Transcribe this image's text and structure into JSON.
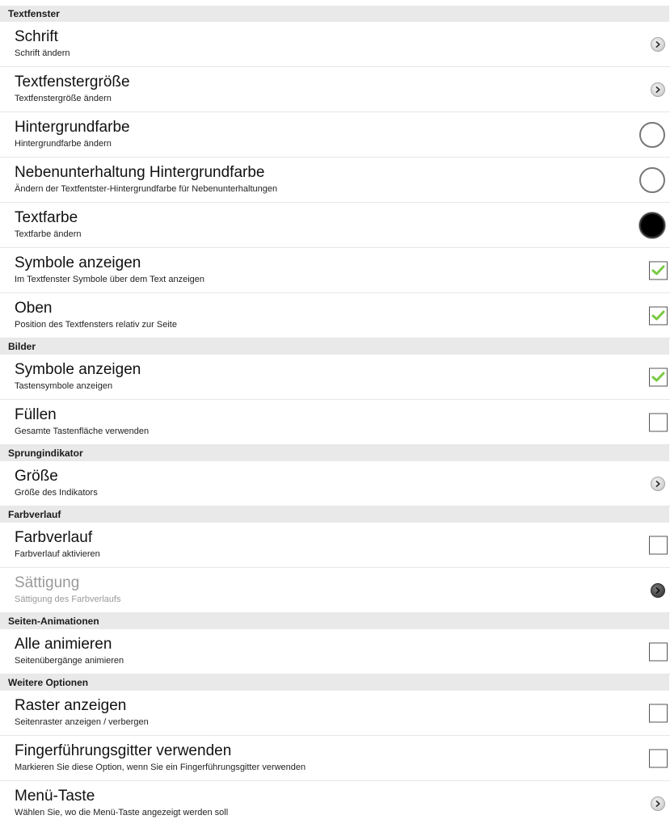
{
  "sections": [
    {
      "header": "Textfenster",
      "rows": [
        {
          "title": "Schrift",
          "subtitle": "Schrift ändern",
          "control": "arrow"
        },
        {
          "title": "Textfenstergröße",
          "subtitle": "Textfenstergröße ändern",
          "control": "arrow"
        },
        {
          "title": "Hintergrundfarbe",
          "subtitle": "Hintergrundfarbe ändern",
          "control": "color",
          "color": "#ffffff"
        },
        {
          "title": "Nebenunterhaltung Hintergrundfarbe",
          "subtitle": "Ändern der Textfentster-Hintergrundfarbe für Nebenunterhaltungen",
          "control": "color",
          "color": "#ffffff"
        },
        {
          "title": "Textfarbe",
          "subtitle": "Textfarbe ändern",
          "control": "color",
          "color": "#000000"
        },
        {
          "title": "Symbole anzeigen",
          "subtitle": "Im Textfenster Symbole über dem Text anzeigen",
          "control": "checkbox",
          "checked": true
        },
        {
          "title": "Oben",
          "subtitle": "Position des Textfensters relativ zur Seite",
          "control": "checkbox",
          "checked": true
        }
      ]
    },
    {
      "header": "Bilder",
      "rows": [
        {
          "title": "Symbole anzeigen",
          "subtitle": "Tastensymbole anzeigen",
          "control": "checkbox",
          "checked": true
        },
        {
          "title": "Füllen",
          "subtitle": "Gesamte Tastenfläche verwenden",
          "control": "checkbox",
          "checked": false
        }
      ]
    },
    {
      "header": "Sprungindikator",
      "rows": [
        {
          "title": "Größe",
          "subtitle": "Größe des Indikators",
          "control": "arrow"
        }
      ]
    },
    {
      "header": "Farbverlauf",
      "rows": [
        {
          "title": "Farbverlauf",
          "subtitle": "Farbverlauf aktivieren",
          "control": "checkbox",
          "checked": false
        },
        {
          "title": "Sättigung",
          "subtitle": "Sättigung des Farbverlaufs",
          "control": "arrow",
          "disabled": true
        }
      ]
    },
    {
      "header": "Seiten-Animationen",
      "rows": [
        {
          "title": "Alle animieren",
          "subtitle": "Seitenübergänge animieren",
          "control": "checkbox",
          "checked": false
        }
      ]
    },
    {
      "header": "Weitere Optionen",
      "rows": [
        {
          "title": "Raster anzeigen",
          "subtitle": "Seitenraster anzeigen / verbergen",
          "control": "checkbox",
          "checked": false
        },
        {
          "title": "Fingerführungsgitter verwenden",
          "subtitle": "Markieren Sie diese Option, wenn Sie ein Fingerführungsgitter verwenden",
          "control": "checkbox",
          "checked": false
        },
        {
          "title": "Menü-Taste",
          "subtitle": "Wählen Sie, wo die Menü-Taste angezeigt werden soll",
          "control": "arrow"
        }
      ]
    }
  ],
  "colors": {
    "check_green": "#7ac943",
    "header_bg": "#e9e9e9"
  },
  "icons": {
    "arrow": "chevron-right-icon",
    "checkmark": "checkmark-icon"
  }
}
